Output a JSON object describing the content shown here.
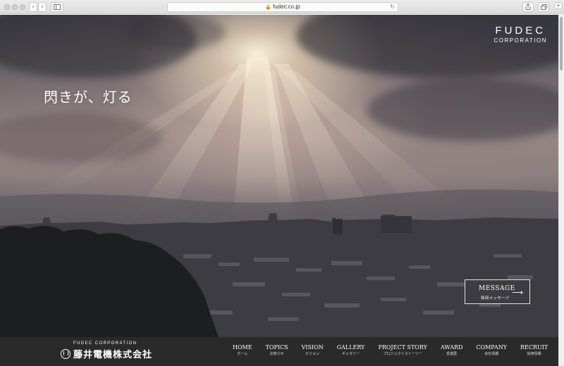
{
  "browser": {
    "url": "fudec.co.jp",
    "back_glyph": "‹",
    "forward_glyph": "›",
    "reload_glyph": "↻",
    "lock_icon": "lock-icon"
  },
  "hero": {
    "logo_line1": "FUDEC",
    "logo_line2": "CORPORATION",
    "tagline": "閃きが、灯る",
    "message_button": {
      "title": "MESSAGE",
      "subtitle": "採用メッセージ",
      "arrow": "⟶"
    }
  },
  "footer": {
    "corp_en": "FUDEC CORPORATION",
    "corp_ja": "藤井電機株式会社",
    "nav": [
      {
        "en": "HOME",
        "ja": "ホーム"
      },
      {
        "en": "TOPICS",
        "ja": "お知らせ"
      },
      {
        "en": "VISION",
        "ja": "ビジョン"
      },
      {
        "en": "GALLERY",
        "ja": "ギャラリー"
      },
      {
        "en": "PROJECT STORY",
        "ja": "プロジェクトストーリー"
      },
      {
        "en": "AWARD",
        "ja": "受賞歴"
      },
      {
        "en": "COMPANY",
        "ja": "会社情報"
      },
      {
        "en": "RECRUIT",
        "ja": "採用情報"
      }
    ]
  },
  "colors": {
    "footer_bg": "#2a2a2a",
    "text_white": "#ffffff"
  }
}
